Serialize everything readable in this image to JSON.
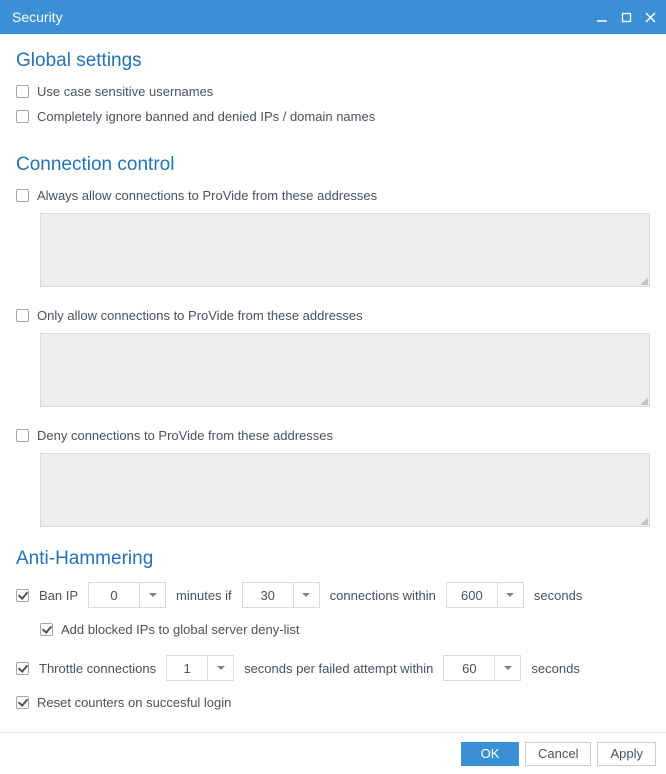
{
  "window": {
    "title": "Security"
  },
  "sections": {
    "global": {
      "heading": "Global settings",
      "case_sensitive": {
        "label": "Use case sensitive usernames",
        "checked": false
      },
      "ignore_banned": {
        "label": "Completely ignore banned and denied IPs / domain names",
        "checked": false
      }
    },
    "connection": {
      "heading": "Connection control",
      "always_allow": {
        "label": "Always allow connections to ProVide from these addresses",
        "checked": false,
        "value": ""
      },
      "only_allow": {
        "label": "Only allow connections to ProVide from these addresses",
        "checked": false,
        "value": ""
      },
      "deny": {
        "label": "Deny connections to ProVide from these addresses",
        "checked": false,
        "value": ""
      }
    },
    "anti": {
      "heading": "Anti-Hammering",
      "ban_ip": {
        "checked": true,
        "label_banip": "Ban IP",
        "minutes": "0",
        "label_minutes_if": "minutes if",
        "connections": "30",
        "label_conn_within": "connections within",
        "seconds": "600",
        "label_seconds": "seconds"
      },
      "add_blocked": {
        "label": "Add blocked IPs to global server deny-list",
        "checked": true
      },
      "throttle": {
        "checked": true,
        "label_throttle": "Throttle connections",
        "per": "1",
        "label_spfaw": "seconds per failed attempt within",
        "within": "60",
        "label_seconds": "seconds"
      },
      "reset": {
        "label": "Reset counters on succesful login",
        "checked": true
      }
    }
  },
  "footer": {
    "ok": "OK",
    "cancel": "Cancel",
    "apply": "Apply"
  }
}
